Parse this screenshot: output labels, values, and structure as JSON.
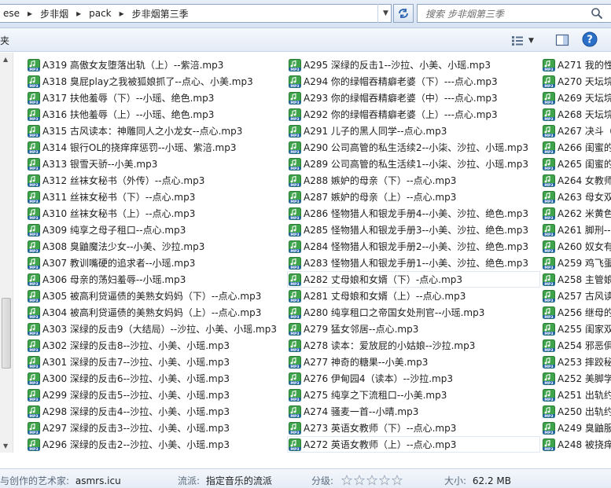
{
  "address": {
    "crumbs": [
      "ese",
      "步非烟",
      "pack",
      "步非烟第三季"
    ],
    "search_placeholder": "搜索 步非烟第三季"
  },
  "toolbar": {
    "left_label": "夹"
  },
  "icon_label": "MP3",
  "files": {
    "col1": [
      "A319 高傲女友堕落出轨（上）--紫涪.mp3",
      "A318 臭屁play之我被狐娘抓了--点心、小美.mp3",
      "A317 扶他羞辱（下）--小瑶、绝色.mp3",
      "A316 扶他羞辱（上）--小瑶、绝色.mp3",
      "A315 古风读本：神雕同人之小龙女--点心.mp3",
      "A314 银行OL的挠痒痒惩罚--小瑶、紫涪.mp3",
      "A313 银雪天骄--小美.mp3",
      "A312 丝袜女秘书（外传）--点心.mp3",
      "A311 丝袜女秘书（下）--点心.mp3",
      "A310 丝袜女秘书（上）--点心.mp3",
      "A309 纯享之母子租口--点心.mp3",
      "A308 臭鼬魔法少女--小美、沙拉.mp3",
      "A307 教训嘴硬的追求者--小瑶.mp3",
      "A306 母亲的荡妇羞辱--小瑶.mp3",
      "A305 被高利贷逼债的美熟女妈妈（下）--点心.mp3",
      "A304 被高利贷逼债的美熟女妈妈（上）--点心.mp3",
      "A303 深绿的反击9（大结局）--沙拉、小美、小瑶.mp3",
      "A302 深绿的反击8--沙拉、小美、小瑶.mp3",
      "A301 深绿的反击7--沙拉、小美、小瑶.mp3",
      "A300 深绿的反击6--沙拉、小美、小瑶.mp3",
      "A299 深绿的反击5--沙拉、小美、小瑶.mp3",
      "A298 深绿的反击4--沙拉、小美、小瑶.mp3",
      "A297 深绿的反击3--沙拉、小美、小瑶.mp3",
      "A296 深绿的反击2--沙拉、小美、小瑶.mp3"
    ],
    "col2": [
      "A295 深绿的反击1--沙拉、小美、小瑶.mp3",
      "A294 你的绿帽吞精癖老婆（下）---点心.mp3",
      "A293 你的绿帽吞精癖老婆（中）---点心.mp3",
      "A292 你的绿帽吞精癖老婆（上）---点心.mp3",
      "A291 儿子的黑人同学--点心.mp3",
      "A290 公司高管的私生活续2--小柒、沙拉、小瑶.mp3",
      "A289 公司高管的私生活续1--小柒、沙拉、小瑶.mp3",
      "A288 嫉妒的母亲（下）--点心.mp3",
      "A287 嫉妒的母亲（上）--点心.mp3",
      "A286 怪物猎人和银龙手册4--小美、沙拉、绝色.mp3",
      "A285 怪物猎人和银龙手册3--小美、沙拉、绝色.mp3",
      "A284 怪物猎人和银龙手册2--小美、沙拉、绝色.mp3",
      "A283 怪物猎人和银龙手册1--小美、沙拉、绝色.mp3",
      "A282 丈母娘和女婿（下）-点心.mp3",
      "A281 丈母娘和女婿（上）--点心.mp3",
      "A280 纯享租口之帝国女处刑官--小瑶.mp3",
      "A279 猛女邻居--点心.mp3",
      "A278 读本：爱放屁的小姑娘--沙拉.mp3",
      "A277 神奇的糖果--小美.mp3",
      "A276 伊甸园4（读本）--沙拉.mp3",
      "A275 纯享之下流租口--小美.mp3",
      "A274 骚麦一首--小晴.mp3",
      "A273 英语女教师（下）--点心.mp3",
      "A272 英语女教师（上）--点心.mp3"
    ],
    "col3": [
      "A271 我的性",
      "A270 天坛垸",
      "A269 天坛垸",
      "A268 天坛垸",
      "A267 决斗（",
      "A266 闺蜜的",
      "A265 闺蜜的",
      "A264 女教师",
      "A263 母女双",
      "A262 米黄色",
      "A261 脚刑--",
      "A260 奴女有",
      "A259 鸡飞蛋",
      "A258 主管娘",
      "A257 古风读",
      "A256 继母的",
      "A255 闺家双",
      "A254 邪恶俱",
      "A253 摔跤秘",
      "A252 美脚学",
      "A251 出轨约",
      "A250 出轨约",
      "A249 臭鼬服",
      "A248 被挠痒"
    ]
  },
  "status": {
    "artist_label": "与创作的艺术家:",
    "artist_value": "asmrs.icu",
    "genre_label": "流派:",
    "genre_value": "指定音乐的流派",
    "rating_label": "分级:",
    "rating_stars": 0,
    "size_label": "大小:",
    "size_value": "62.2 MB"
  }
}
